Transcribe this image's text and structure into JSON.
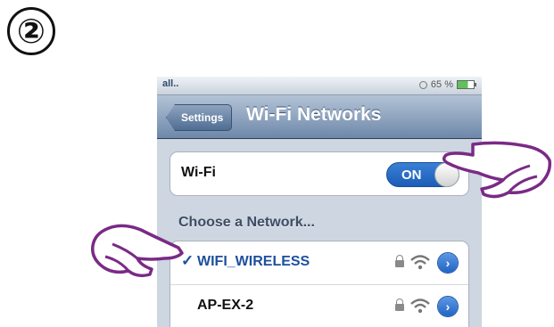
{
  "step": {
    "number": "②"
  },
  "status_bar": {
    "signal": "all..",
    "battery": "65 %"
  },
  "nav": {
    "back_label": "Settings",
    "title": "Wi-Fi Networks"
  },
  "wifi_toggle": {
    "label": "Wi-Fi",
    "state": "ON"
  },
  "networks": {
    "header": "Choose a Network...",
    "items": [
      {
        "check": "✓",
        "name": "WIFI_WIRELESS"
      },
      {
        "check": "",
        "name": "AP-EX-2"
      }
    ]
  },
  "colors": {
    "accent": "#1e4f9d",
    "toggle": "#2a6fcf",
    "hand_outline": "#7a2a86"
  }
}
